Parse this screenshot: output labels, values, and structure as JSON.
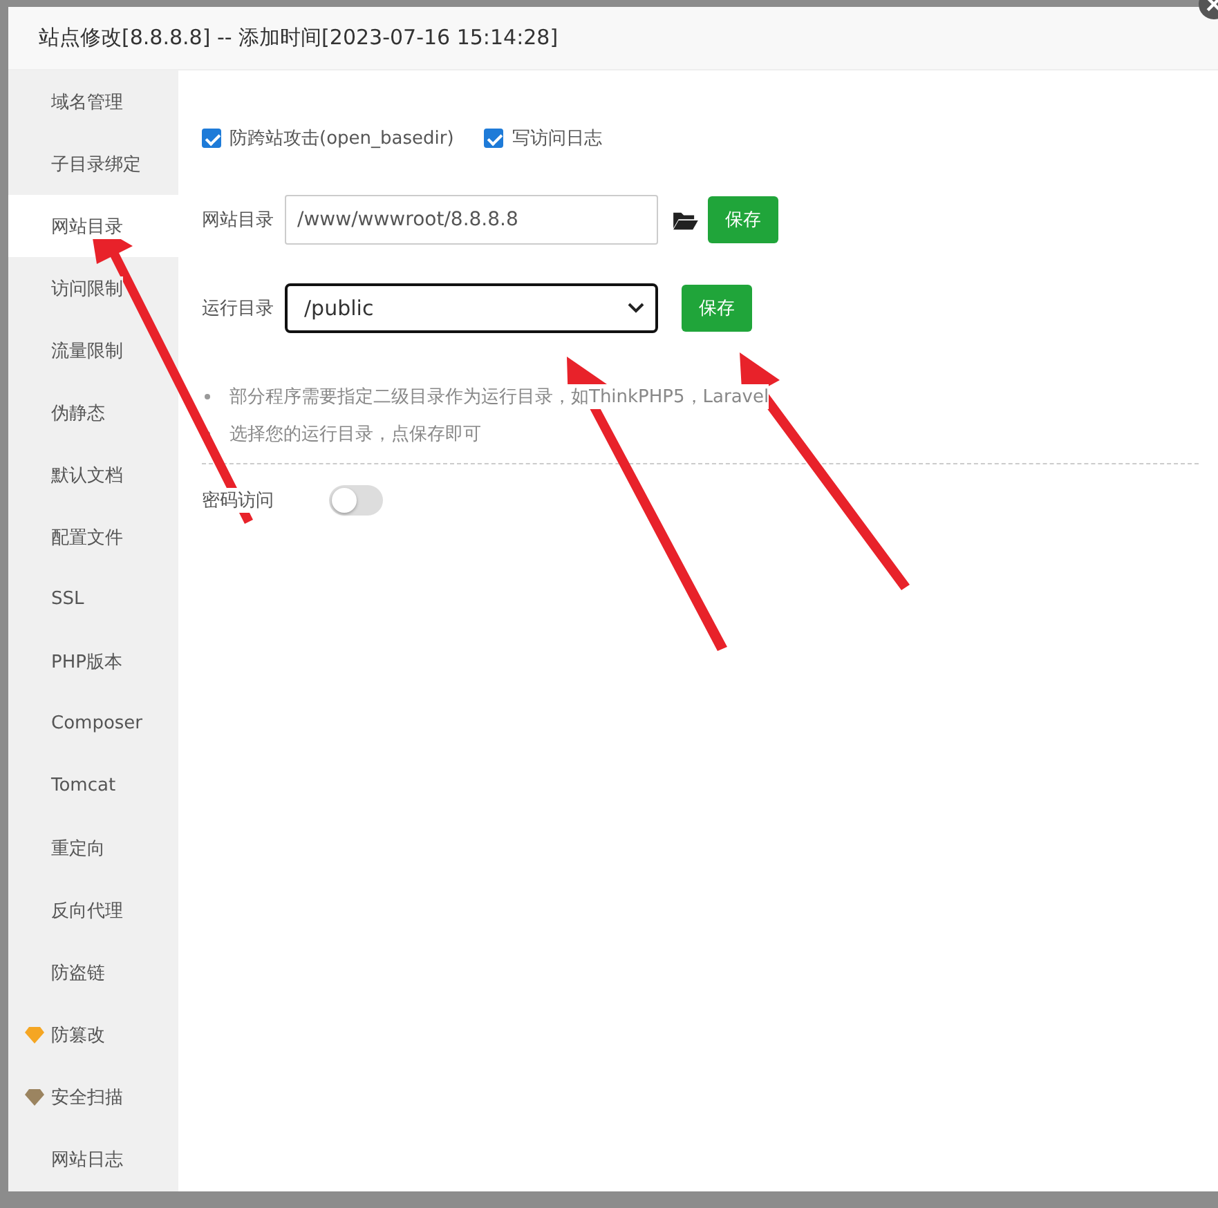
{
  "window": {
    "title": "站点修改[8.8.8.8] -- 添加时间[2023-07-16 15:14:28]"
  },
  "sidebar": {
    "items": [
      {
        "label": "域名管理",
        "selected": false
      },
      {
        "label": "子目录绑定",
        "selected": false
      },
      {
        "label": "网站目录",
        "selected": true
      },
      {
        "label": "访问限制",
        "selected": false
      },
      {
        "label": "流量限制",
        "selected": false
      },
      {
        "label": "伪静态",
        "selected": false
      },
      {
        "label": "默认文档",
        "selected": false
      },
      {
        "label": "配置文件",
        "selected": false
      },
      {
        "label": "SSL",
        "selected": false
      },
      {
        "label": "PHP版本",
        "selected": false
      },
      {
        "label": "Composer",
        "selected": false
      },
      {
        "label": "Tomcat",
        "selected": false
      },
      {
        "label": "重定向",
        "selected": false
      },
      {
        "label": "反向代理",
        "selected": false
      },
      {
        "label": "防盗链",
        "selected": false
      },
      {
        "label": "防篡改",
        "selected": false,
        "color": "#f5a623"
      },
      {
        "label": "安全扫描",
        "selected": false,
        "color": "#9b8460"
      },
      {
        "label": "网站日志",
        "selected": false
      }
    ]
  },
  "options": [
    {
      "label": "防跨站攻击(open_basedir)",
      "checked": true
    },
    {
      "label": "写访问日志",
      "checked": true
    }
  ],
  "site_dir": {
    "label": "网站目录",
    "value": "/www/wwwroot/8.8.8.8",
    "button": "保存"
  },
  "run_dir": {
    "label": "运行目录",
    "value": "/public",
    "button": "保存"
  },
  "hints": [
    "部分程序需要指定二级目录作为运行目录，如ThinkPHP5，Laravel",
    "选择您的运行目录，点保存即可"
  ],
  "password_access": {
    "label": "密码访问",
    "on": false
  }
}
